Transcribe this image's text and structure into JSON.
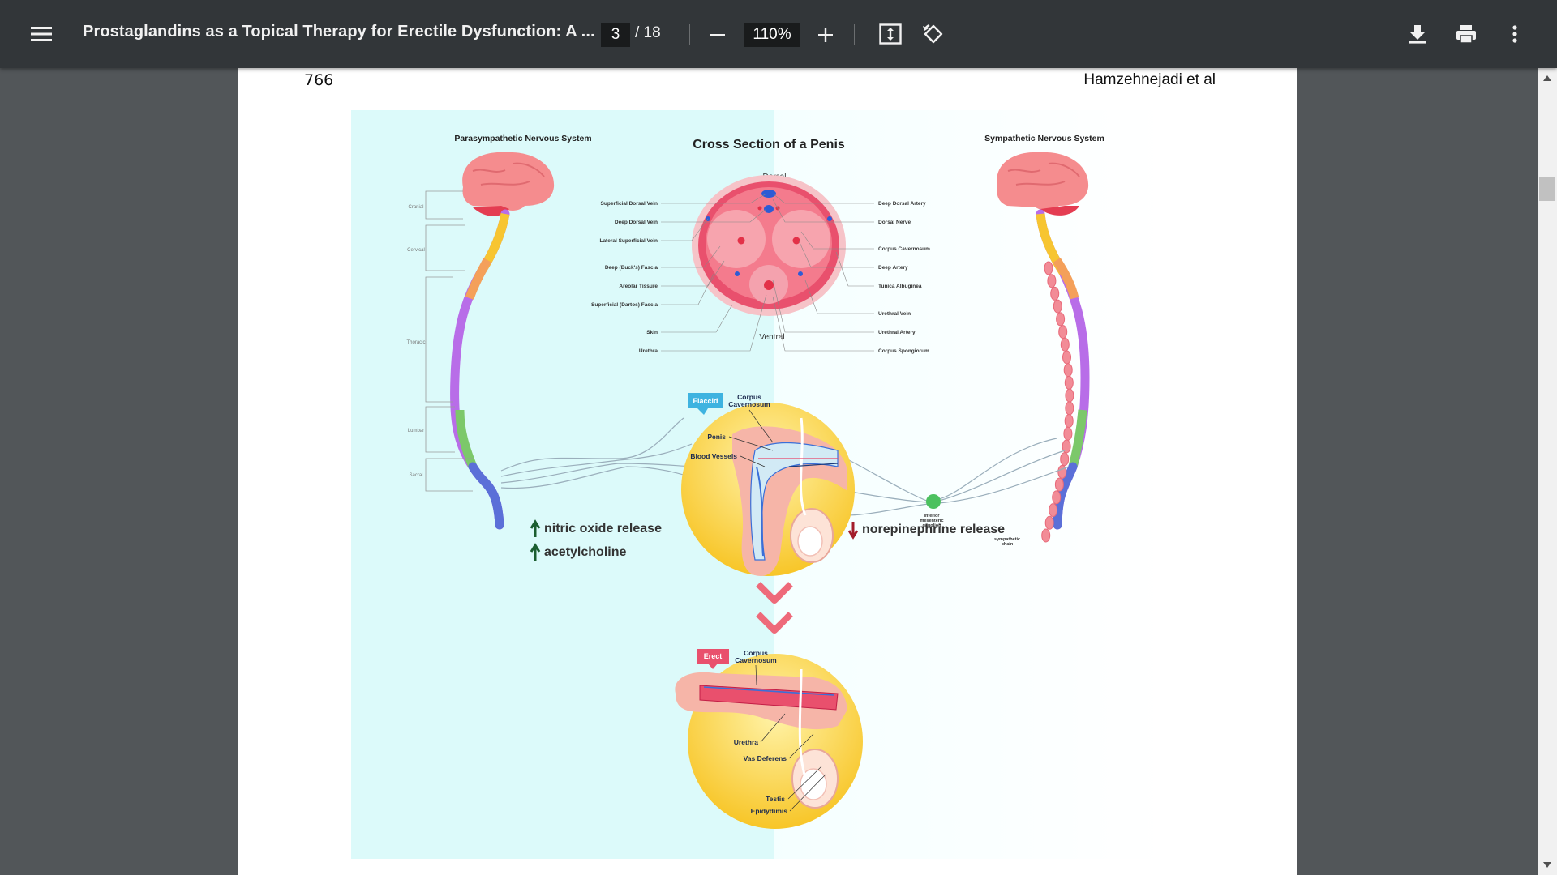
{
  "toolbar": {
    "menu_icon": "hamburger-menu-icon",
    "title": "Prostaglandins as a Topical Therapy for Erectile Dysfunction: A ...",
    "current_page": "3",
    "total_pages": "/ 18",
    "zoom": "110%",
    "zoom_out_icon": "minus-icon",
    "zoom_in_icon": "plus-icon",
    "fit_icon": "fit-to-page-icon",
    "rotate_icon": "rotate-counterclockwise-icon",
    "download_icon": "download-icon",
    "print_icon": "print-icon",
    "more_icon": "more-vertical-icon"
  },
  "page": {
    "page_number": "766",
    "author": "Hamzehnejadi et al"
  },
  "figure": {
    "title": "Cross Section of a Penis",
    "parasympathetic_title": "Parasympathetic Nervous System",
    "sympathetic_title": "Sympathetic Nervous System",
    "dorsal": "Dorsal",
    "ventral": "Ventral",
    "spine_regions": [
      "Cranial",
      "Cervical",
      "Thoracic",
      "Lumbar",
      "Sacral"
    ],
    "left_labels": [
      "Superficial Dorsal Vein",
      "Deep Dorsal Vein",
      "Lateral Superficial Vein",
      "Deep (Buck's) Fascia",
      "Areolar Tissure",
      "Superficial (Dartos) Fascia",
      "Skin",
      "Urethra"
    ],
    "right_labels": [
      "Deep Dorsal Artery",
      "Dorsal Nerve",
      "Corpus Cavernosum",
      "Deep Artery",
      "Tunica Albuginea",
      "Urethral Vein",
      "Urethral Artery",
      "Corpus Spongiorum"
    ],
    "flaccid_tag": "Flaccid",
    "corpus_cavernosum": "Corpus Cavernosum",
    "penis": "Penis",
    "blood_vessels": "Blood Vessels",
    "ganglion": "inferior mesenteric ganglion",
    "sympathetic_chain": "sympathetic chain",
    "nitric_oxide": "nitric oxide release",
    "acetylcholine": "acetylcholine",
    "norepinephrine": "norepinephrine release",
    "erect_tag": "Erect",
    "urethra": "Urethra",
    "vas_deferens": "Vas Deferens",
    "testis": "Testis",
    "epididymis": "Epidydimis",
    "colors": {
      "cyan_bg": "#dcfafa",
      "brain": "#f58c8e",
      "spine_yellow": "#f7c531",
      "spine_orange": "#f4a05a",
      "spine_purple": "#b86de8",
      "spine_green": "#7cc86a",
      "spine_blue": "#5b6fd8",
      "arrow_red": "#ee6a7a",
      "ganglion_green": "#4cc15f"
    }
  }
}
